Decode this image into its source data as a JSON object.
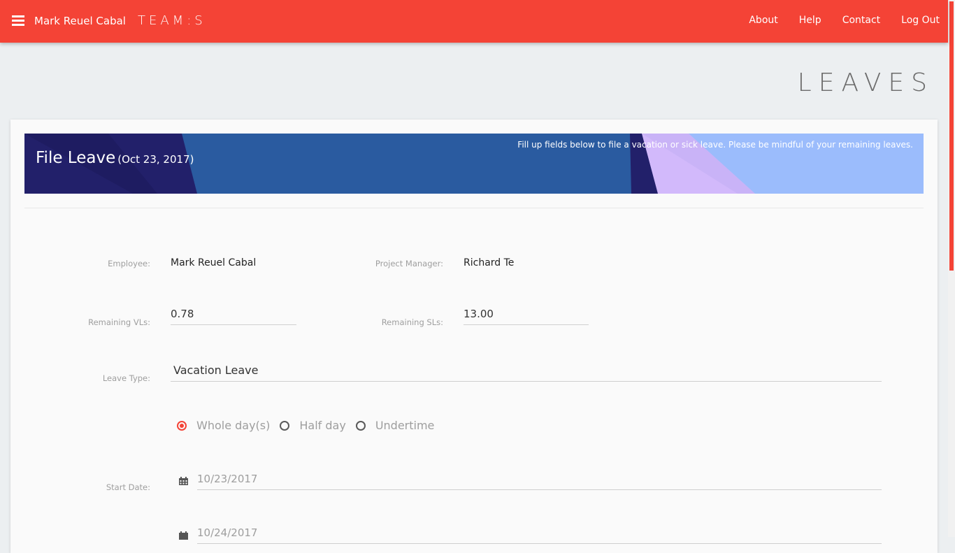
{
  "nav": {
    "user_name": "Mark Reuel Cabal",
    "brand": "TEAM:S",
    "links": [
      "About",
      "Help",
      "Contact",
      "Log Out"
    ]
  },
  "page_heading": "LEAVES",
  "banner": {
    "title": "File Leave",
    "date": "(Oct 23, 2017)",
    "note": "Fill up fields below to file a vacation or sick leave. Please be mindful of your remaining leaves."
  },
  "form": {
    "employee_label": "Employee:",
    "employee_value": "Mark Reuel Cabal",
    "pm_label": "Project Manager:",
    "pm_value": "Richard Te",
    "vl_label": "Remaining VLs:",
    "vl_value": "0.78",
    "sl_label": "Remaining SLs:",
    "sl_value": "13.00",
    "leave_type_label": "Leave Type:",
    "leave_type_value": "Vacation Leave",
    "duration_options": [
      {
        "label": "Whole day(s)",
        "checked": true
      },
      {
        "label": "Half day",
        "checked": false
      },
      {
        "label": "Undertime",
        "checked": false
      }
    ],
    "start_date_label": "Start Date:",
    "start_date_value": "10/23/2017",
    "end_date_value": "10/24/2017"
  },
  "colors": {
    "accent": "#f44336",
    "banner_dark": "#22206a",
    "banner_blue": "#2a5ba0",
    "banner_lavender": "#d2b9fb",
    "banner_light": "#9bbcfc"
  },
  "icons": {
    "menu": "hamburger-menu-icon",
    "calendar": "calendar-icon"
  }
}
